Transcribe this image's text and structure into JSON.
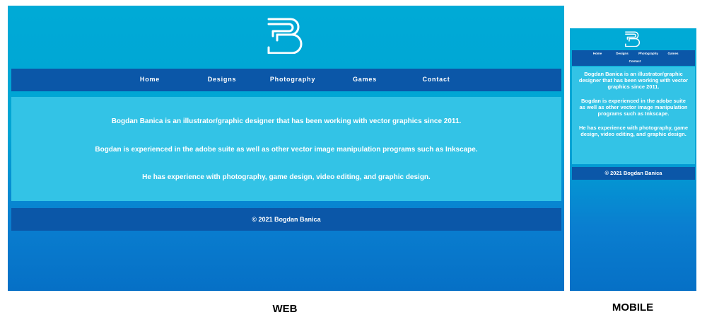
{
  "colors": {
    "background": "#00aad6",
    "nav": "#0b57a8",
    "content": "#33c3e6",
    "text": "#ffffff"
  },
  "logo": {
    "icon": "b-monogram-logo-icon"
  },
  "nav": {
    "items": [
      {
        "label": "Home"
      },
      {
        "label": "Designs"
      },
      {
        "label": "Photography"
      },
      {
        "label": "Games"
      },
      {
        "label": "Contact"
      }
    ]
  },
  "content": {
    "paragraphs": [
      "Bogdan Banica is an illustrator/graphic designer that has been working with vector graphics since 2011.",
      "Bogdan is experienced in the adobe suite as well as other vector image manipulation programs such as Inkscape.",
      "He has experience with photography, game design, video editing, and graphic design."
    ]
  },
  "footer": {
    "text": "© 2021 Bogdan Banica"
  },
  "captions": {
    "web": "WEB",
    "mobile": "MOBILE"
  }
}
